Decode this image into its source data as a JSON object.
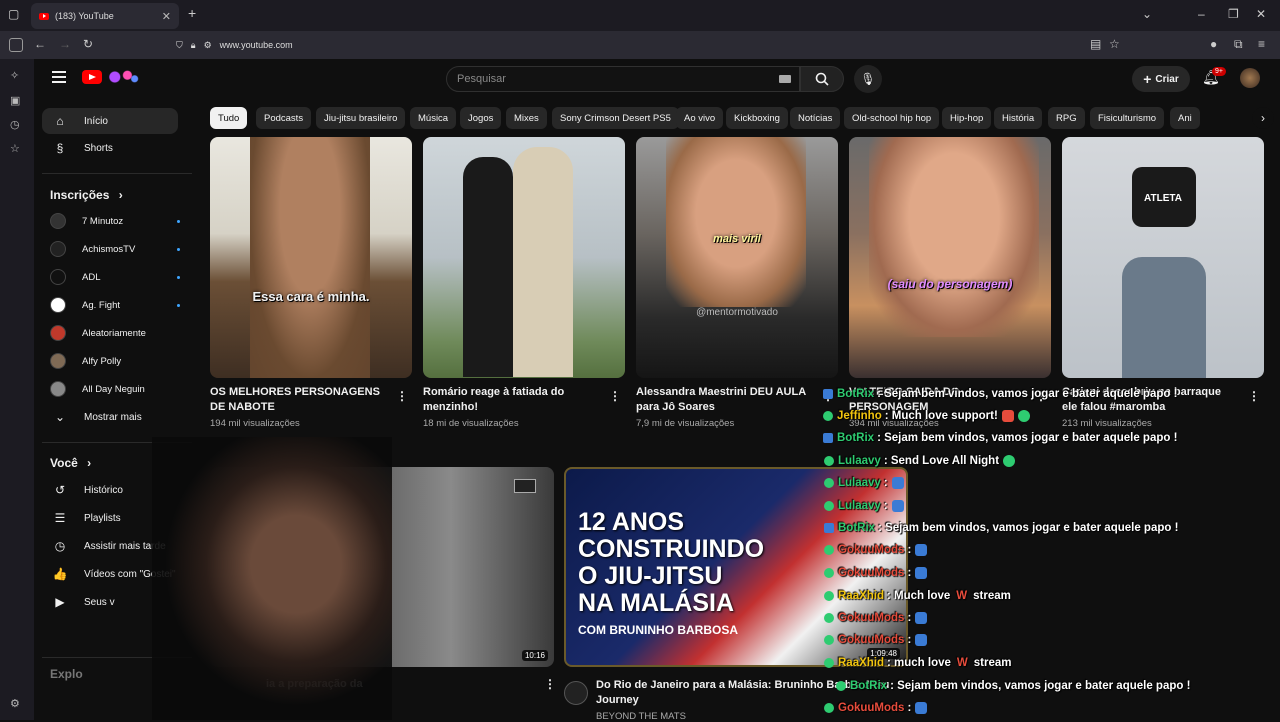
{
  "browser": {
    "tab_title": "(183) YouTube",
    "tab_close": "✕",
    "new_tab": "+",
    "url": "www.youtube.com"
  },
  "youtube": {
    "search_placeholder": "Pesquisar",
    "create_label": "Criar",
    "notifications_badge": "9+",
    "sidebar": {
      "main": [
        {
          "label": "Início",
          "icon": "home-icon",
          "glyph": "⌂"
        },
        {
          "label": "Shorts",
          "icon": "shorts-icon",
          "glyph": "§"
        }
      ],
      "subs_header": "Inscrições",
      "subs": [
        {
          "label": "7 Minutoz",
          "color": "#333333"
        },
        {
          "label": "AchismosTV",
          "color": "#222222"
        },
        {
          "label": "ADL",
          "color": "#111111"
        },
        {
          "label": "Ag. Fight",
          "color": "#ffffff"
        },
        {
          "label": "Aleatoriamente",
          "color": "#c0392b"
        },
        {
          "label": "Alfy Polly",
          "color": "#7f6a55"
        },
        {
          "label": "All Day Neguin",
          "color": "#888888"
        }
      ],
      "show_more": "Mostrar mais",
      "you_header": "Você",
      "you": [
        {
          "label": "Histórico",
          "icon": "history-icon",
          "glyph": "↺"
        },
        {
          "label": "Playlists",
          "icon": "playlists-icon",
          "glyph": "☰"
        },
        {
          "label": "Assistir mais tarde",
          "icon": "clock-icon",
          "glyph": "◷"
        },
        {
          "label": "Vídeos com \"Gostei\"",
          "icon": "thumb-up-icon",
          "glyph": "👍"
        },
        {
          "label": "Seus v",
          "icon": "your-videos-icon",
          "glyph": "▶"
        }
      ],
      "explore_header": "Explo"
    },
    "chips": [
      "Tudo",
      "Podcasts",
      "Jiu-jitsu brasileiro",
      "Música",
      "Jogos",
      "Mixes",
      "Sony Crimson Desert PS5",
      "Ao vivo",
      "Kickboxing",
      "Notícias",
      "Old-school hip hop",
      "Hip-hop",
      "História",
      "RPG",
      "Fisiculturismo",
      "Ani"
    ],
    "videos": [
      {
        "title": "OS MELHORES PERSONAGENS DE NABOTE",
        "views": "194 mil visualizações",
        "caption": "Essa cara é minha."
      },
      {
        "title": "Romário reage à fatiada do menzinho!",
        "views": "18 mi de visualizações",
        "caption": ""
      },
      {
        "title": "Alessandra Maestrini DEU AULA para Jô Soares",
        "views": "7,9 mi de visualizações",
        "caption": "mais viril",
        "watermark": "@mentormotivado"
      },
      {
        "title": "VALTEIRO SAIDA DO PERSONAGEM",
        "views": "394 mil visualizações",
        "caption": "(saiu do personagem)"
      },
      {
        "title": "Cariani descobriu na barraque ele falou #maromba #musculação ...",
        "views": "213 mil visualizações",
        "caption": "ATLETA"
      }
    ],
    "row2": [
      {
        "title": "ia a preparação da",
        "duration": "10:16"
      },
      {
        "title": "Do Rio de Janeiro para a Malásia: Bruninho Barb s Jitsu Journey",
        "channel": "BEYOND THE MATS",
        "duration": "1:09:48",
        "big1": "12 ANOS",
        "big2": "CONSTRUINDO",
        "big3": "O JIU-JITSU",
        "big4": "NA MALÁSIA",
        "sub": "COM BRUNINHO BARBOSA"
      }
    ]
  },
  "chat": [
    {
      "user": "BotRix",
      "msg": ": Sejam bem vindos, vamos jogar e bater aquele papo !",
      "color": "#2ecc71",
      "kind": "box"
    },
    {
      "user": "Jeffinho",
      "msg": ": Much love support!",
      "color": "#f1c40f",
      "kind": "dot"
    },
    {
      "user": "BotRix",
      "msg": ": Sejam bem vindos, vamos jogar e bater aquele papo !",
      "color": "#2ecc71",
      "kind": "box"
    },
    {
      "user": "Lulaavy",
      "msg": ": Send Love All Night",
      "color": "#2ecc71",
      "kind": "dot"
    },
    {
      "user": "Lulaavy",
      "msg": ":",
      "color": "#2ecc71",
      "kind": "dot"
    },
    {
      "user": "Lulaavy",
      "msg": ":",
      "color": "#2ecc71",
      "kind": "dot"
    },
    {
      "user": "BotRix",
      "msg": ": Sejam bem vindos, vamos jogar e bater aquele papo !",
      "color": "#2ecc71",
      "kind": "box"
    },
    {
      "user": "GokuuMods",
      "msg": ":",
      "color": "#e74c3c",
      "kind": "dot"
    },
    {
      "user": "GokuuMods",
      "msg": ":",
      "color": "#e74c3c",
      "kind": "dot"
    },
    {
      "user": "RaaXhid",
      "msg": ": Much love",
      "color": "#f1c40f",
      "kind": "dot",
      "tail": "stream"
    },
    {
      "user": "GokuuMods",
      "msg": ":",
      "color": "#e74c3c",
      "kind": "dot"
    },
    {
      "user": "GokuuMods",
      "msg": ":",
      "color": "#e74c3c",
      "kind": "dot"
    },
    {
      "user": "RaaXhid",
      "msg": ": much love",
      "color": "#f1c40f",
      "kind": "dot",
      "tail": "stream"
    },
    {
      "user": "BotRix",
      "msg": ": Sejam bem vindos, vamos jogar e bater aquele papo !",
      "color": "#2ecc71",
      "kind": "dot"
    },
    {
      "user": "GokuuMods",
      "msg": ":",
      "color": "#e74c3c",
      "kind": "dot"
    }
  ]
}
